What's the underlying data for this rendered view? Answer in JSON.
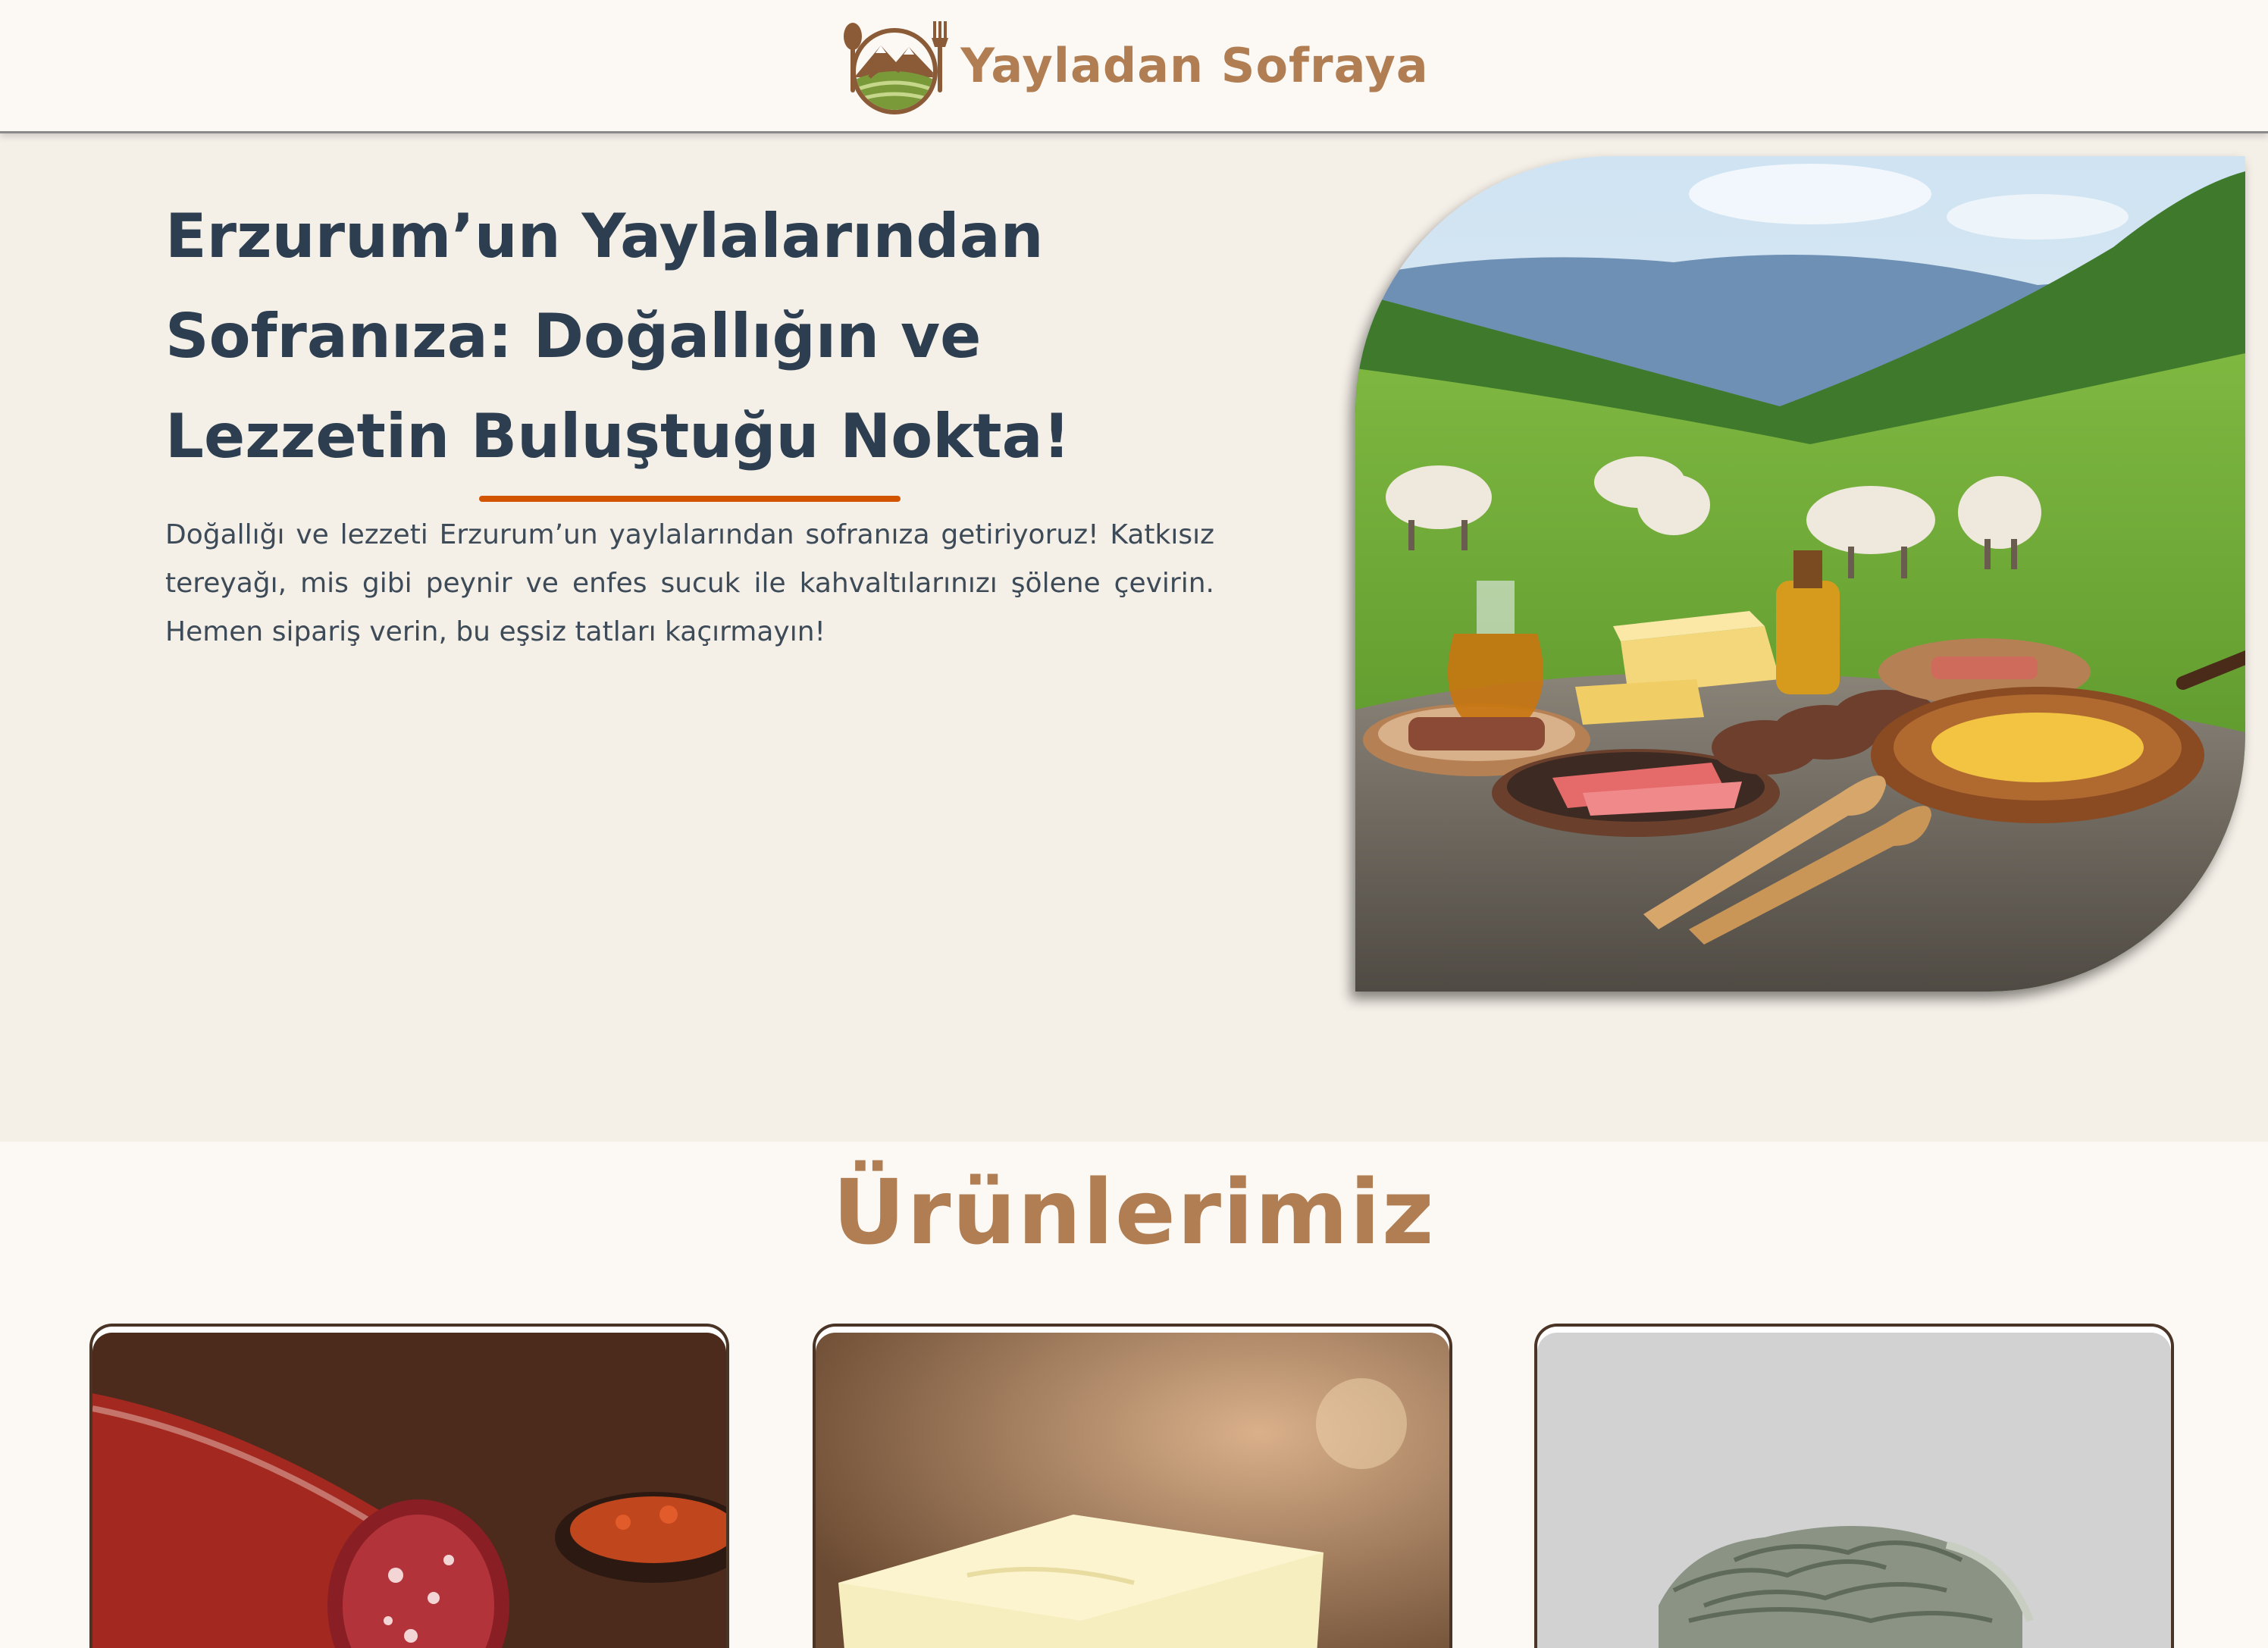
{
  "header": {
    "brand_name": "Yayladan Sofraya",
    "logo_icon": "mountain-fork-spoon-logo"
  },
  "hero": {
    "title": "Erzurum’un Yaylalarından Sofranıza: Doğallığın ve Lezzetin Buluştuğu Nokta!",
    "description": "Doğallığı ve lezzeti Erzurum’un yaylalarından sofranıza getiriyoruz! Katkısız tereyağı, mis gibi peynir ve enfes sucuk ile kahvaltılarınızı şölene çevirin. Hemen sipariş verin, bu eşsiz tatları kaçırmayın!",
    "accent_color": "#d35400"
  },
  "products": {
    "title": "Ürünlerimiz",
    "items": [
      {
        "image": "sucuk-photo"
      },
      {
        "image": "butter-photo"
      },
      {
        "image": "otlu-cheese-photo"
      }
    ]
  },
  "colors": {
    "brand": "#b07e52",
    "heading": "#2c3e50",
    "hero_bg": "#f4efe7",
    "page_bg": "#fcf9f5"
  }
}
